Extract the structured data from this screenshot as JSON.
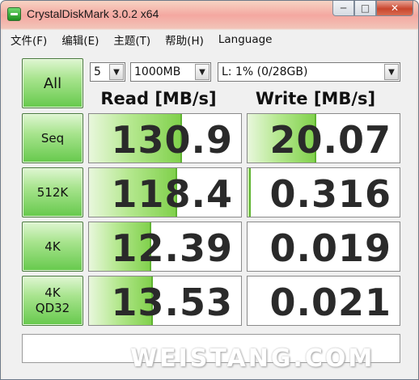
{
  "window": {
    "title": "CrystalDiskMark 3.0.2 x64",
    "buttons": {
      "minimize": "─",
      "maximize": "□",
      "close": "✕"
    }
  },
  "menu": [
    "文件(F)",
    "编辑(E)",
    "主题(T)",
    "帮助(H)",
    "Language"
  ],
  "controls": {
    "all_label": "All",
    "runs": "5",
    "size": "1000MB",
    "drive": "L: 1% (0/28GB)"
  },
  "headers": {
    "read": "Read [MB/s]",
    "write": "Write [MB/s]"
  },
  "tests": [
    {
      "label_line1": "Seq",
      "label_line2": "",
      "read": "130.9",
      "write": "20.07",
      "read_fill": 0.61,
      "write_fill": 0.45
    },
    {
      "label_line1": "512K",
      "label_line2": "",
      "read": "118.4",
      "write": "0.316",
      "read_fill": 0.58,
      "write_fill": 0.02
    },
    {
      "label_line1": "4K",
      "label_line2": "",
      "read": "12.39",
      "write": "0.019",
      "read_fill": 0.41,
      "write_fill": 0.0
    },
    {
      "label_line1": "4K",
      "label_line2": "QD32",
      "read": "13.53",
      "write": "0.021",
      "read_fill": 0.42,
      "write_fill": 0.0
    }
  ],
  "comment": "",
  "watermark": "WEISTANG.COM",
  "colors": {
    "accent_green": "#66c94c",
    "bar_green": "#7fd04a"
  }
}
